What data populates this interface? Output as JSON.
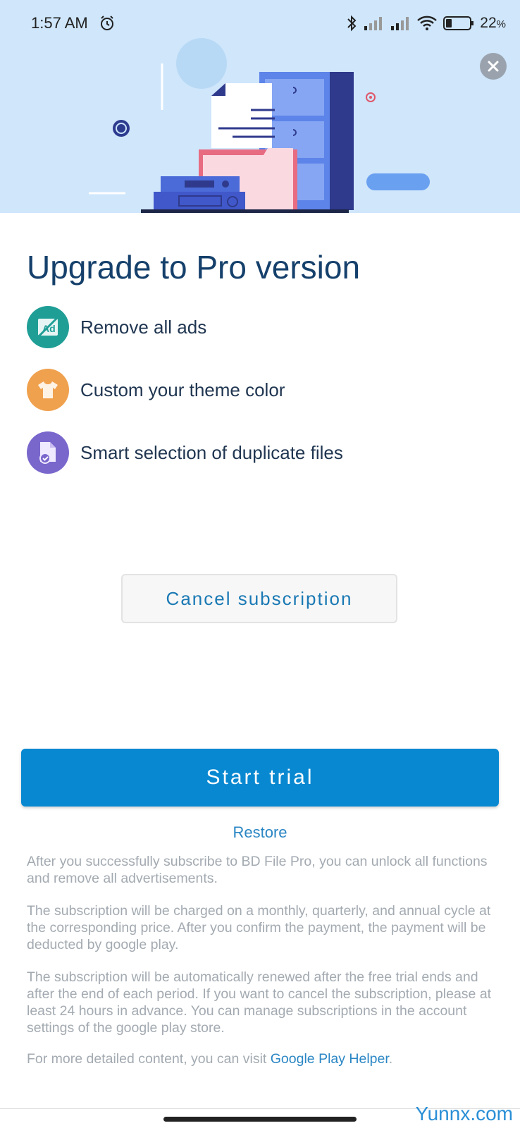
{
  "status_bar": {
    "time": "1:57 AM",
    "battery_percent": "22",
    "battery_suffix": "%",
    "icons": [
      "alarm-icon",
      "bluetooth-icon",
      "signal-icon",
      "signal-icon",
      "wifi-icon",
      "battery-icon"
    ]
  },
  "header": {
    "close_icon": "close-icon"
  },
  "title": "Upgrade to Pro version",
  "features": [
    {
      "label": "Remove all ads",
      "icon": "no-ads-icon",
      "color": "#1f9e96"
    },
    {
      "label": "Custom your theme color",
      "icon": "shirt-icon",
      "color": "#f0a14e"
    },
    {
      "label": "Smart selection of duplicate files",
      "icon": "file-check-icon",
      "color": "#7a67cc"
    }
  ],
  "buttons": {
    "cancel_subscription": "Cancel subscription",
    "start_trial": "Start trial",
    "restore": "Restore"
  },
  "fine_print": {
    "p1": "After you successfully subscribe to BD File Pro, you can unlock all functions and remove all advertisements.",
    "p2": "The subscription will be charged on a monthly, quarterly, and annual cycle at the corresponding price. After you confirm the payment, the payment will be deducted by google play.",
    "p3": "The subscription will be automatically renewed after the free trial ends and after the end of each period. If you want to cancel the subscription, please at least 24 hours in advance. You can manage subscriptions in the account settings of the google play store.",
    "p4_prefix": "For more detailed content, you can visit ",
    "p4_link": "Google Play Helper",
    "p4_suffix": "."
  },
  "watermark": "Yunnx.com",
  "colors": {
    "hero_bg": "#cfe6fb",
    "primary": "#0888d1",
    "title": "#15406b",
    "link": "#2a86c4"
  }
}
